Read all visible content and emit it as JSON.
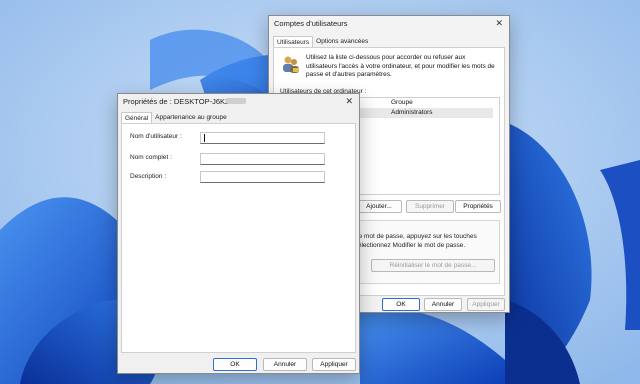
{
  "main_dialog": {
    "title": "Comptes d'utilisateurs",
    "tabs": [
      "Utilisateurs",
      "Options avancées"
    ],
    "intro_text": "Utilisez la liste ci-dessous pour accorder ou refuser aux utilisateurs l'accès à votre ordinateur, et pour modifier les mots de passe et d'autres paramètres.",
    "list_label": "Utilisateurs de cet ordinateur :",
    "list_header": "Groupe",
    "list_rows": [
      {
        "group": "Administrators"
      }
    ],
    "add_button": "Ajouter...",
    "remove_button": "Supprimer",
    "properties_button": "Propriétés",
    "password_text_line1": "otre mot de passe, appuyez sur les touches",
    "password_text_line2": "t sélectionnez Modifier le mot de passe.",
    "reset_password_button": "Réinitialiser le mot de passe...",
    "ok": "OK",
    "cancel": "Annuler",
    "apply": "Appliquer"
  },
  "props_dialog": {
    "title": "Propriétés de : DESKTOP-J6K286H",
    "tabs": [
      "Général",
      "Appartenance au groupe"
    ],
    "fields": [
      {
        "label": "Nom d'utilisateur :",
        "value": ""
      },
      {
        "label": "Nom complet :",
        "value": ""
      },
      {
        "label": "Description :",
        "value": ""
      }
    ],
    "ok": "OK",
    "cancel": "Annuler",
    "apply": "Appliquer"
  },
  "close_glyph": "✕",
  "colors": {
    "accent": "#2f6fd1",
    "wallpaper_light": "#9cc3ef",
    "bloom_blue": "#1f5fd6"
  }
}
